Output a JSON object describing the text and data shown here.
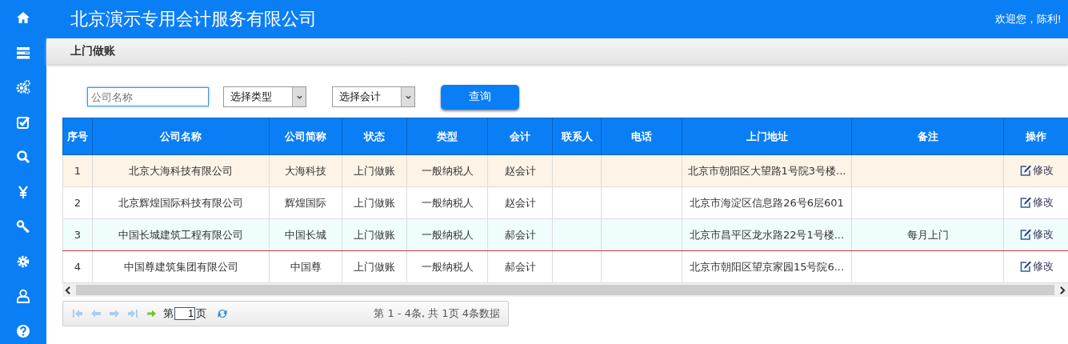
{
  "header": {
    "title": "北京演示专用会计服务有限公司",
    "welcome": "欢迎您，陈利!"
  },
  "sidebar": {
    "items": [
      {
        "kind": "home"
      },
      {
        "kind": "list"
      },
      {
        "kind": "gears"
      },
      {
        "kind": "check"
      },
      {
        "kind": "search"
      },
      {
        "kind": "yen"
      },
      {
        "kind": "key"
      },
      {
        "kind": "gear"
      },
      {
        "kind": "user"
      },
      {
        "kind": "help"
      }
    ]
  },
  "breadcrumb": "上门做账",
  "filters": {
    "company": {
      "placeholder": "公司名称"
    },
    "type_select": {
      "value": "选择类型"
    },
    "accountant_select": {
      "value": "选择会计"
    },
    "query_button": "查询"
  },
  "table": {
    "columns": [
      "序号",
      "公司名称",
      "公司简称",
      "状态",
      "类型",
      "会计",
      "联系人",
      "电话",
      "上门地址",
      "备注",
      "操作"
    ],
    "rows": [
      {
        "no": "1",
        "name": "北京大海科技有限公司",
        "short": "大海科技",
        "status": "上门做账",
        "type": "一般纳税人",
        "accountant": "赵会计",
        "contact": "",
        "phone": "",
        "address": "北京市朝阳区大望路1号院3号楼...",
        "note": "",
        "action": "修改",
        "hovered": true,
        "selected": false
      },
      {
        "no": "2",
        "name": "北京辉煌国际科技有限公司",
        "short": "辉煌国际",
        "status": "上门做账",
        "type": "一般纳税人",
        "accountant": "赵会计",
        "contact": "",
        "phone": "",
        "address": "北京市海淀区信息路26号6层601",
        "note": "",
        "action": "修改",
        "hovered": false,
        "selected": false
      },
      {
        "no": "3",
        "name": "中国长城建筑工程有限公司",
        "short": "中国长城",
        "status": "上门做账",
        "type": "一般纳税人",
        "accountant": "郝会计",
        "contact": "",
        "phone": "",
        "address": "北京市昌平区龙水路22号1号楼...",
        "note": "每月上门",
        "action": "修改",
        "hovered": false,
        "selected": true
      },
      {
        "no": "4",
        "name": "中国尊建筑集团有限公司",
        "short": "中国尊",
        "status": "上门做账",
        "type": "一般纳税人",
        "accountant": "郝会计",
        "contact": "",
        "phone": "",
        "address": "北京市朝阳区望京家园15号院6...",
        "note": "",
        "action": "修改",
        "hovered": false,
        "selected": false
      }
    ]
  },
  "pager": {
    "page_prefix": "第",
    "page": "1",
    "page_suffix": "页",
    "info": "第 1 - 4条, 共 1页 4条数据"
  }
}
